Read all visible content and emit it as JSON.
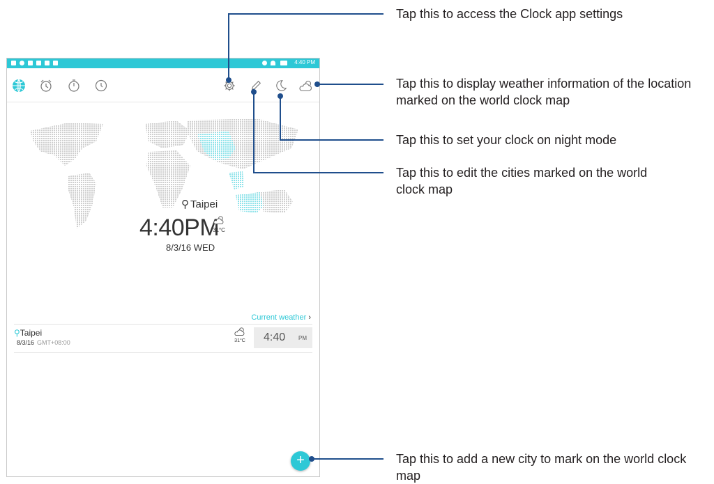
{
  "status_bar": {
    "time": "4:40 PM"
  },
  "toolbar": {
    "tabs": [
      "world-clock",
      "alarm",
      "stopwatch",
      "timer"
    ],
    "actions": [
      "settings",
      "edit",
      "night-mode",
      "weather"
    ]
  },
  "map": {
    "city": "Taipei",
    "time": "4:40PM",
    "temp": "31°C",
    "date": "8/3/16 WED"
  },
  "current_weather_link": "Current weather",
  "city_list": [
    {
      "name": "Taipei",
      "date": "8/3/16",
      "gmt": "GMT+08:00",
      "temp": "31°C",
      "time": "4:40",
      "ampm": "PM"
    }
  ],
  "callouts": {
    "settings": "Tap this to access the Clock app settings",
    "weather": "Tap this to display weather information of the location marked on the world clock map",
    "night_mode": "Tap this to set your clock on night mode",
    "edit": "Tap this to edit the cities marked on the world clock map",
    "add_city": "Tap this to add a new city to mark on the world clock map"
  },
  "colors": {
    "accent": "#2dc8d6",
    "callout_line": "#1f4e8c"
  }
}
